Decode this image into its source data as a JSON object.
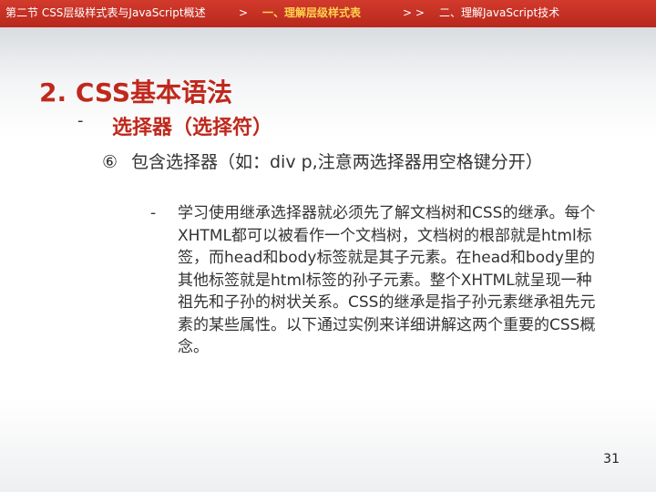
{
  "header": {
    "chapter": "第二节 CSS层级样式表与JavaScript概述",
    "sep1": ">",
    "current": "一、理解层级样式表",
    "sep2": "> >",
    "next": "二、理解JavaScript技术"
  },
  "slide": {
    "title": "2. CSS基本语法",
    "level1": {
      "bullet": "-",
      "text": "选择器（选择符）"
    },
    "level2": {
      "number": "⑥",
      "text": "包含选择器（如：div p,注意两选择器用空格键分开）"
    },
    "level3": {
      "bullet": "-",
      "text": "学习使用继承选择器就必须先了解文档树和CSS的继承。每个XHTML都可以被看作一个文档树，文档树的根部就是html标签，而head和body标签就是其子元素。在head和body里的其他标签就是html标签的孙子元素。整个XHTML就呈现一种祖先和子孙的树状关系。CSS的继承是指子孙元素继承祖先元素的某些属性。以下通过实例来详细讲解这两个重要的CSS概念。"
    },
    "page_number": "31"
  },
  "colors": {
    "header_bg": "#c0281c",
    "title": "#c0281c",
    "header_current": "#ffd34d",
    "body_text": "#333333"
  }
}
